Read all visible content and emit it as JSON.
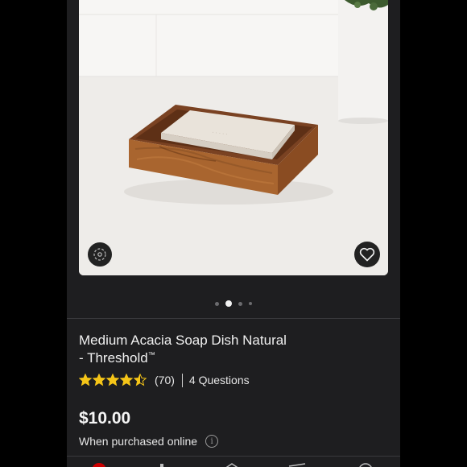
{
  "product": {
    "title_line1": "Medium Acacia Soap Dish Natural",
    "title_line2": "- Threshold",
    "trademark": "™",
    "rating": 4.5,
    "rating_max": 5,
    "review_count": "(70)",
    "questions": "4 Questions",
    "price": "$10.00",
    "price_note": "When purchased online",
    "info_glyph": "i"
  },
  "gallery": {
    "image_count": 4,
    "active_index": 1
  },
  "icons": {
    "ar": "view-in-room-icon",
    "favorite": "heart-icon",
    "info": "info-icon"
  },
  "colors": {
    "background": "#1e1e20",
    "star": "#f5c518",
    "brand": "#cc0000",
    "text": "#f0f0f0"
  }
}
